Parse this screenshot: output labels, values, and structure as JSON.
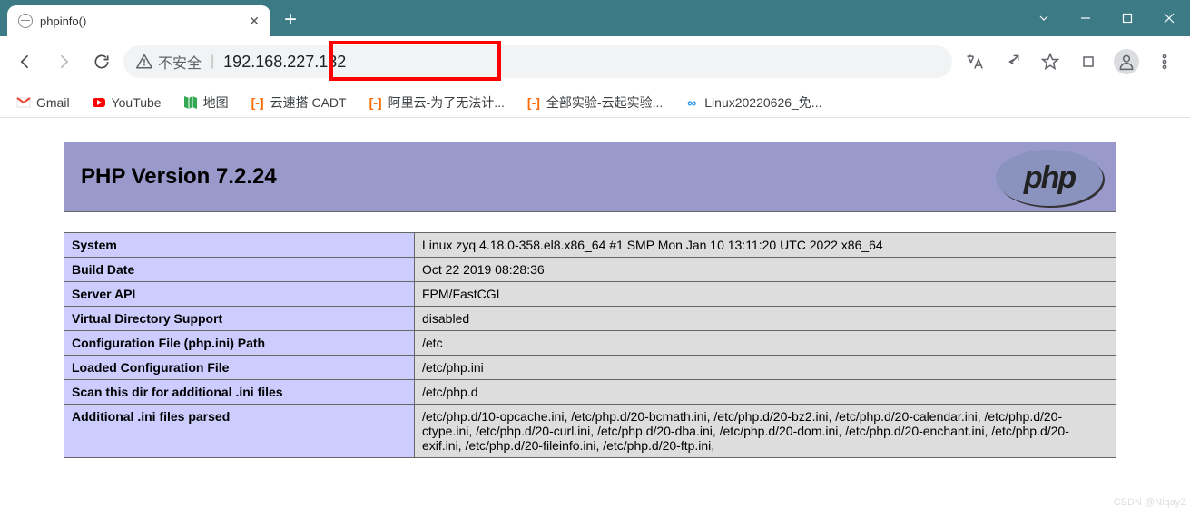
{
  "window": {
    "tab_title": "phpinfo()"
  },
  "urlbar": {
    "insecure_label": "不安全",
    "url": "192.168.227.132"
  },
  "bookmarks": [
    {
      "id": "gmail",
      "label": "Gmail"
    },
    {
      "id": "youtube",
      "label": "YouTube"
    },
    {
      "id": "maps",
      "label": "地图"
    },
    {
      "id": "cadt",
      "label": "云速搭 CADT"
    },
    {
      "id": "aliyun",
      "label": "阿里云-为了无法计..."
    },
    {
      "id": "labs",
      "label": "全部实验-云起实验..."
    },
    {
      "id": "linux",
      "label": "Linux20220626_免..."
    }
  ],
  "php": {
    "version_title": "PHP Version 7.2.24",
    "logo_text": "php",
    "rows": [
      {
        "k": "System",
        "v": "Linux zyq 4.18.0-358.el8.x86_64 #1 SMP Mon Jan 10 13:11:20 UTC 2022 x86_64"
      },
      {
        "k": "Build Date",
        "v": "Oct 22 2019 08:28:36"
      },
      {
        "k": "Server API",
        "v": "FPM/FastCGI"
      },
      {
        "k": "Virtual Directory Support",
        "v": "disabled"
      },
      {
        "k": "Configuration File (php.ini) Path",
        "v": "/etc"
      },
      {
        "k": "Loaded Configuration File",
        "v": "/etc/php.ini"
      },
      {
        "k": "Scan this dir for additional .ini files",
        "v": "/etc/php.d"
      },
      {
        "k": "Additional .ini files parsed",
        "v": "/etc/php.d/10-opcache.ini, /etc/php.d/20-bcmath.ini, /etc/php.d/20-bz2.ini, /etc/php.d/20-calendar.ini, /etc/php.d/20-ctype.ini, /etc/php.d/20-curl.ini, /etc/php.d/20-dba.ini, /etc/php.d/20-dom.ini, /etc/php.d/20-enchant.ini, /etc/php.d/20-exif.ini, /etc/php.d/20-fileinfo.ini, /etc/php.d/20-ftp.ini,"
      }
    ]
  },
  "watermark": "CSDN @NiqayZ"
}
